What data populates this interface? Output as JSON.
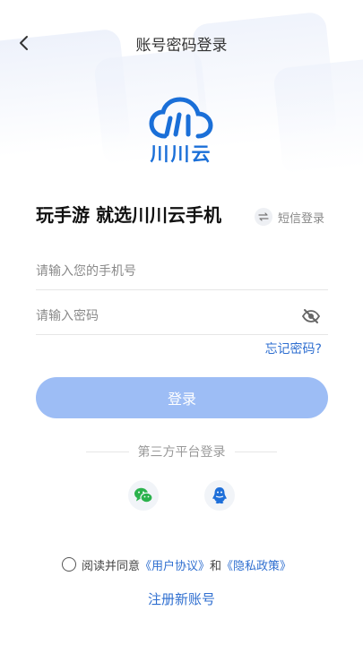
{
  "header": {
    "title": "账号密码登录"
  },
  "brand": {
    "name": "川川云"
  },
  "slogan": "玩手游 就选川川云手机",
  "sms_switch": {
    "label": "短信登录"
  },
  "phone": {
    "placeholder": "请输入您的手机号",
    "value": ""
  },
  "password": {
    "placeholder": "请输入密码",
    "value": ""
  },
  "forgot": "忘记密码?",
  "login_button": "登录",
  "third_party": {
    "label": "第三方平台登录"
  },
  "agreement": {
    "prefix": "阅读并同意",
    "user_agreement": "《用户协议》",
    "and": "和",
    "privacy_policy": "《隐私政策》"
  },
  "register": "注册新账号",
  "colors": {
    "accent": "#2f6fd0",
    "logo": "#1a6fd8",
    "button_disabled": "#9dbdf5"
  }
}
